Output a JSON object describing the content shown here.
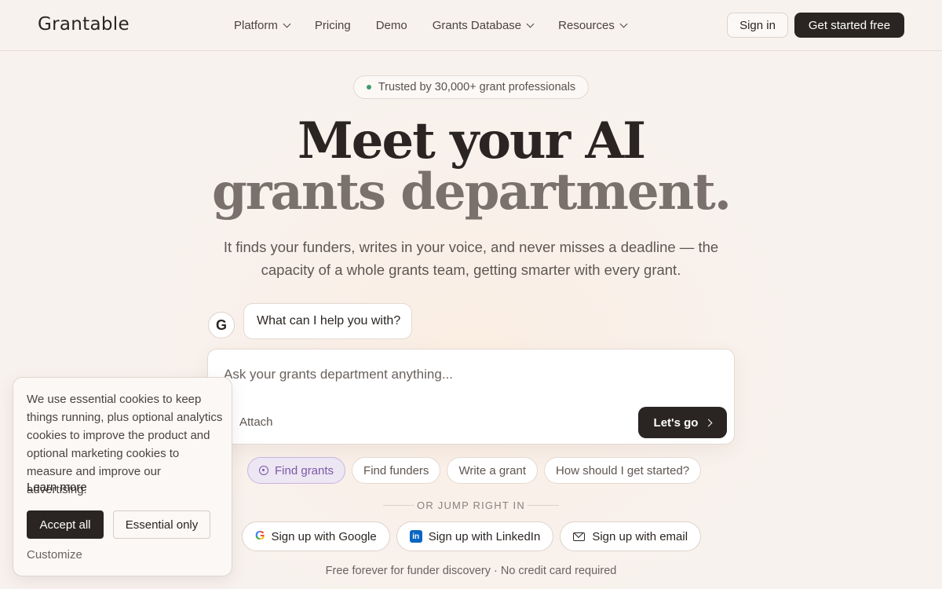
{
  "brand": {
    "logo_text": "Grantable"
  },
  "nav": {
    "items": [
      {
        "label": "Platform",
        "dropdown": true
      },
      {
        "label": "Pricing",
        "dropdown": false
      },
      {
        "label": "Demo",
        "dropdown": false
      },
      {
        "label": "Grants Database",
        "dropdown": true
      },
      {
        "label": "Resources",
        "dropdown": true
      }
    ],
    "sign_in": "Sign in",
    "get_started": "Get started free"
  },
  "hero": {
    "badge": "Trusted by 30,000+ grant professionals",
    "title_line1": "Meet your AI",
    "title_line2": "grants department.",
    "subtitle": "It finds your funders, writes in your voice, and never misses a deadline — the capacity of a whole grants team, getting smarter with every grant."
  },
  "chat": {
    "avatar_letter": "G",
    "prompt_bubble": "What can I help you with?",
    "input_placeholder": "Ask your grants department anything...",
    "attach_label": "Attach",
    "submit_label": "Let's go"
  },
  "chips": [
    {
      "label": "Find grants",
      "active": true
    },
    {
      "label": "Find funders",
      "active": false
    },
    {
      "label": "Write a grant",
      "active": false
    },
    {
      "label": "How should I get started?",
      "active": false
    }
  ],
  "jump": {
    "divider_text": "OR JUMP RIGHT IN",
    "google": "Sign up with Google",
    "linkedin": "Sign up with LinkedIn",
    "email": "Sign up with email",
    "footnote": "Free forever for funder discovery · No credit card required"
  },
  "cookie": {
    "text": "We use essential cookies to keep things running, plus optional analytics cookies to improve the product and optional marketing cookies to measure and improve our advertising.",
    "learn_more": "Learn more",
    "accept_all": "Accept all",
    "essential_only": "Essential only",
    "customize": "Customize"
  },
  "colors": {
    "primary_dark": "#2a2522",
    "accent_purple": "#7a58a6",
    "badge_dot": "#3f9b6e",
    "background": "#f8f2ee"
  }
}
